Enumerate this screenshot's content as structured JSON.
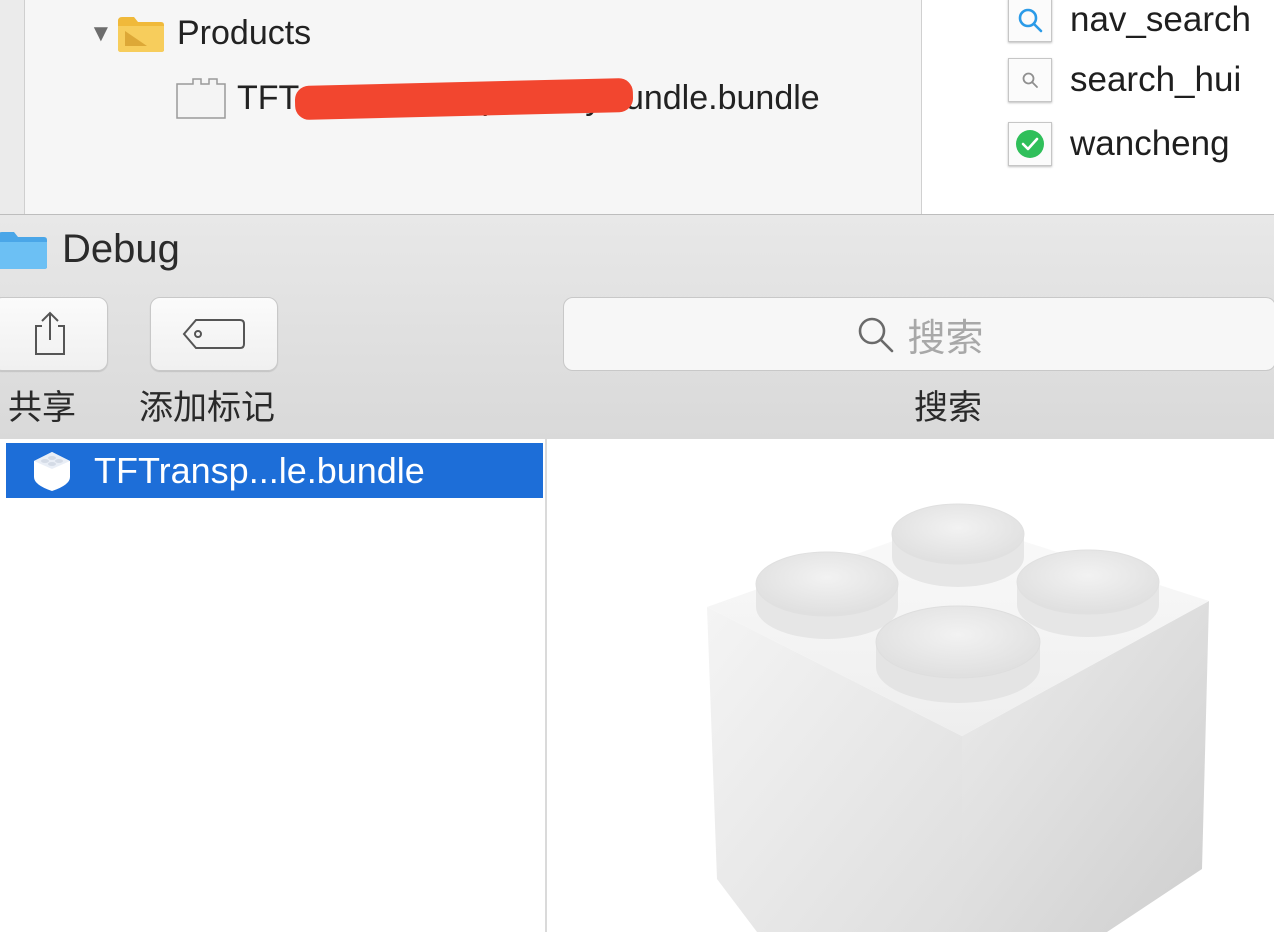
{
  "navigator": {
    "products_label": "Products",
    "bundle_label_visible": "TFT",
    "bundle_label_suffix": "parencyBundle.bundle"
  },
  "assets": [
    {
      "label": "nav_search",
      "icon": "search-icon-blue"
    },
    {
      "label": "search_hui",
      "icon": "search-icon-gray"
    },
    {
      "label": "wancheng",
      "icon": "check-circle-icon"
    }
  ],
  "finder": {
    "title": "Debug",
    "share_label": "共享",
    "add_tag_label": "添加标记",
    "search_placeholder": "搜索",
    "search_label": "搜索"
  },
  "file_list": {
    "selected_item": "TFTransp...le.bundle"
  },
  "colors": {
    "selection": "#1d6ed8",
    "redaction": "#f2462f",
    "folder_yellow": "#f5c242",
    "folder_blue": "#5ab2ee"
  }
}
